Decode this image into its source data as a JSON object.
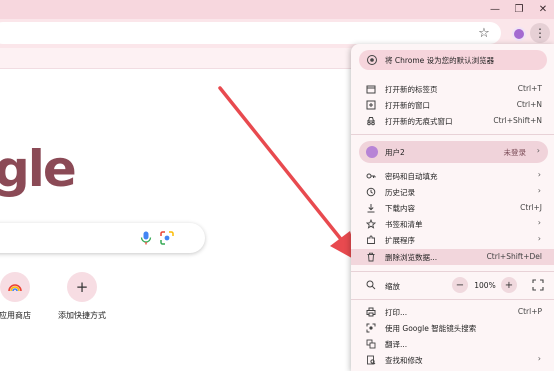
{
  "window": {
    "min_glyph": "—",
    "max_glyph": "❐",
    "close_glyph": "✕"
  },
  "toolbar": {
    "menu_glyph": "⋮",
    "star_glyph": "☆"
  },
  "ntp": {
    "logo_text": "gle",
    "shortcuts": [
      {
        "label": "应用商店",
        "icon": "rainbow-icon"
      },
      {
        "label": "添加快捷方式",
        "icon": "plus-icon",
        "glyph": "+"
      }
    ]
  },
  "menu": {
    "banner": "将 Chrome 设为您的默认浏览器",
    "items_group1": [
      {
        "label": "打开新的标签页",
        "shortcut": "Ctrl+T",
        "icon": "new-tab-icon"
      },
      {
        "label": "打开新的窗口",
        "shortcut": "Ctrl+N",
        "icon": "new-window-icon"
      },
      {
        "label": "打开新的无痕式窗口",
        "shortcut": "Ctrl+Shift+N",
        "icon": "incognito-icon"
      }
    ],
    "profile": {
      "name": "用户2",
      "status": "未登录"
    },
    "items_group2": [
      {
        "label": "密码和自动填充",
        "icon": "key-icon",
        "chevron": true
      },
      {
        "label": "历史记录",
        "icon": "history-icon",
        "chevron": true
      },
      {
        "label": "下载内容",
        "shortcut": "Ctrl+J",
        "icon": "download-icon"
      },
      {
        "label": "书签和清单",
        "icon": "bookmark-icon",
        "chevron": true
      },
      {
        "label": "扩展程序",
        "icon": "extension-icon",
        "chevron": true
      },
      {
        "label": "删除浏览数据...",
        "shortcut": "Ctrl+Shift+Del",
        "icon": "trash-icon"
      }
    ],
    "zoom": {
      "label": "缩放",
      "value": "100%",
      "minus": "−",
      "plus": "+"
    },
    "items_group3": [
      {
        "label": "打印...",
        "shortcut": "Ctrl+P",
        "icon": "print-icon"
      },
      {
        "label": "使用 Google 智能镜头搜索",
        "icon": "lens-icon"
      },
      {
        "label": "翻译...",
        "icon": "translate-icon"
      },
      {
        "label": "查找和修改",
        "icon": "find-icon",
        "chevron": true
      }
    ],
    "chevron_glyph": "›"
  }
}
